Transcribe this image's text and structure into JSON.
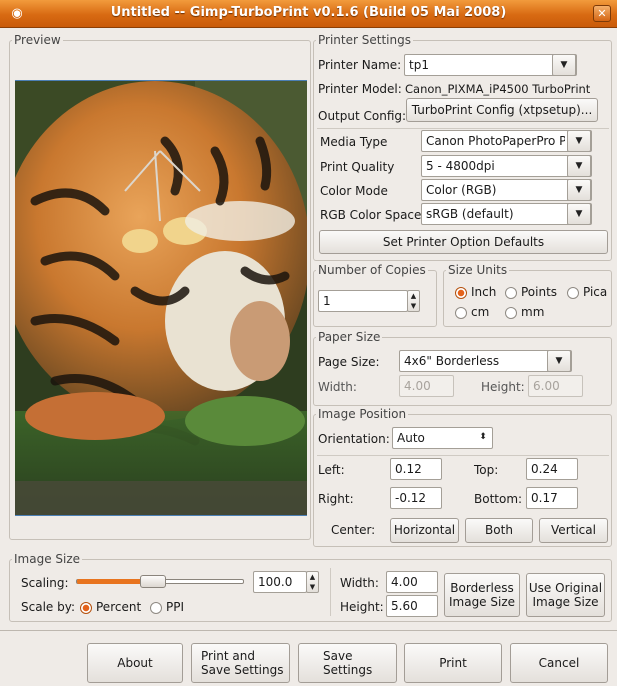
{
  "window": {
    "title": "Untitled -- Gimp-TurboPrint v0.1.6 (Build 05 Mai 2008)",
    "app_icon": "gimp-icon",
    "close_glyph": "✕",
    "accent_color": "#d86a12"
  },
  "preview": {
    "legend": "Preview"
  },
  "printer_settings": {
    "legend": "Printer Settings",
    "printer_name_label": "Printer Name:",
    "printer_name_value": "tp1",
    "printer_model_label": "Printer Model:",
    "printer_model_value": "Canon_PIXMA_iP4500 TurboPrint",
    "output_config_label": "Output Config:",
    "output_config_button": "TurboPrint Config (xtpsetup)...",
    "media_type_label": "Media Type",
    "media_type_value": "Canon PhotoPaperPro P",
    "print_quality_label": "Print Quality",
    "print_quality_value": "5 - 4800dpi",
    "color_mode_label": "Color Mode",
    "color_mode_value": "Color (RGB)",
    "rgb_space_label": "RGB Color Space",
    "rgb_space_value": "sRGB (default)",
    "defaults_button": "Set Printer Option Defaults"
  },
  "copies": {
    "legend": "Number of Copies",
    "value": "1"
  },
  "size_units": {
    "legend": "Size Units",
    "options": [
      "Inch",
      "Points",
      "Pica",
      "cm",
      "mm"
    ],
    "selected": "Inch"
  },
  "paper_size": {
    "legend": "Paper Size",
    "page_size_label": "Page Size:",
    "page_size_value": "4x6\" Borderless",
    "width_label": "Width:",
    "width_value": "4.00",
    "height_label": "Height:",
    "height_value": "6.00"
  },
  "image_position": {
    "legend": "Image Position",
    "orientation_label": "Orientation:",
    "orientation_value": "Auto",
    "left_label": "Left:",
    "left_value": "0.12",
    "top_label": "Top:",
    "top_value": "0.24",
    "right_label": "Right:",
    "right_value": "-0.12",
    "bottom_label": "Bottom:",
    "bottom_value": "0.17",
    "center_label": "Center:",
    "horizontal_button": "Horizontal",
    "both_button": "Both",
    "vertical_button": "Vertical"
  },
  "image_size": {
    "legend": "Image Size",
    "scaling_label": "Scaling:",
    "scaling_value": "100.0",
    "scaling_level_fraction": 0.45,
    "scale_by_label": "Scale by:",
    "scale_by_options": [
      "Percent",
      "PPI"
    ],
    "scale_by_selected": "Percent",
    "width_label": "Width:",
    "width_value": "4.00",
    "height_label": "Height:",
    "height_value": "5.60",
    "borderless_button_line1": "Borderless",
    "borderless_button_line2": "Image Size",
    "original_button_line1": "Use Original",
    "original_button_line2": "Image Size"
  },
  "footer": {
    "about_button": "About",
    "print_save_line1": "Print and",
    "print_save_line2": "Save Settings",
    "save_line1": "Save",
    "save_line2": "Settings",
    "print_button": "Print",
    "cancel_button": "Cancel"
  }
}
